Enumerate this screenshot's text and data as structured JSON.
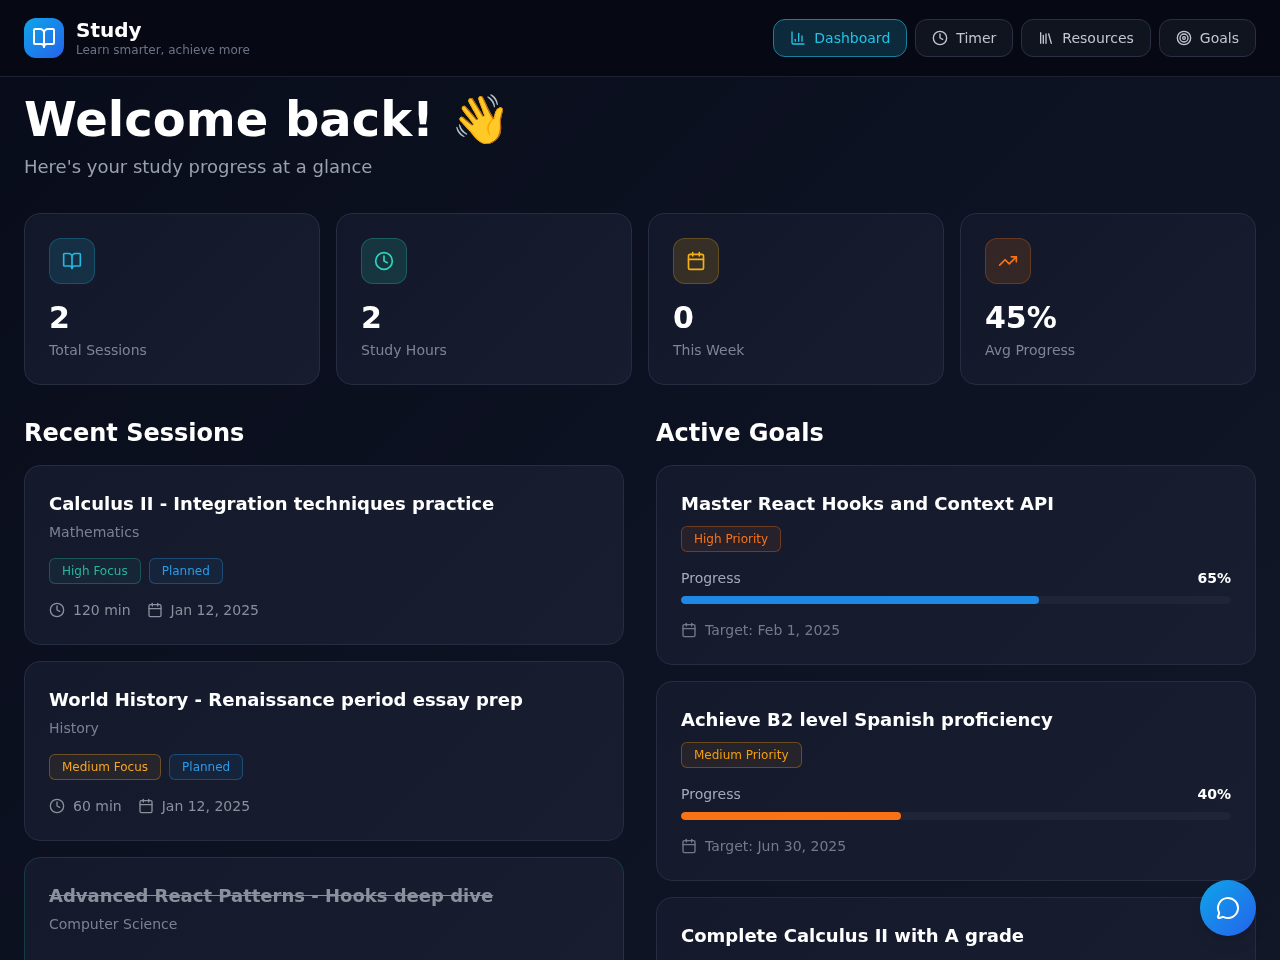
{
  "header": {
    "title": "Study",
    "subtitle": "Learn smarter, achieve more"
  },
  "nav": [
    {
      "label": "Dashboard",
      "selected": true
    },
    {
      "label": "Timer",
      "selected": false
    },
    {
      "label": "Resources",
      "selected": false
    },
    {
      "label": "Goals",
      "selected": false
    }
  ],
  "welcome": {
    "title": "Welcome back! 👋",
    "subtitle": "Here's your study progress at a glance"
  },
  "stats": [
    {
      "value": "2",
      "label": "Total Sessions",
      "color": "#22b8e0"
    },
    {
      "value": "2",
      "label": "Study Hours",
      "color": "#2dd4bf"
    },
    {
      "value": "0",
      "label": "This Week",
      "color": "#f5b014"
    },
    {
      "value": "45%",
      "label": "Avg Progress",
      "color": "#f97316"
    }
  ],
  "recent_sessions": {
    "heading": "Recent Sessions",
    "sessions": [
      {
        "title": "Calculus II - Integration techniques practice",
        "subject": "Mathematics",
        "completed": false,
        "tags": [
          {
            "label": "High Focus",
            "color": "#2ab3a0"
          },
          {
            "label": "Planned",
            "color": "#2b9be8"
          }
        ],
        "duration": "120 min",
        "date": "Jan 12, 2025"
      },
      {
        "title": "World History - Renaissance period essay prep",
        "subject": "History",
        "completed": false,
        "tags": [
          {
            "label": "Medium Focus",
            "color": "#f5a623"
          },
          {
            "label": "Planned",
            "color": "#2b9be8"
          }
        ],
        "duration": "60 min",
        "date": "Jan 12, 2025"
      },
      {
        "title": "Advanced React Patterns - Hooks deep dive",
        "subject": "Computer Science",
        "completed": true
      }
    ]
  },
  "active_goals": {
    "heading": "Active Goals",
    "goals": [
      {
        "title": "Master React Hooks and Context API",
        "priority": {
          "label": "High Priority",
          "color": "#f97316"
        },
        "progress_label": "Progress",
        "reading": "65%",
        "level": 0.65,
        "color": "#1e88e5",
        "target": "Target: Feb 1, 2025"
      },
      {
        "title": "Achieve B2 level Spanish proficiency",
        "priority": {
          "label": "Medium Priority",
          "color": "#f59e0b"
        },
        "progress_label": "Progress",
        "reading": "40%",
        "level": 0.4,
        "color": "#f97316",
        "target": "Target: Jun 30, 2025"
      },
      {
        "title": "Complete Calculus II with A grade"
      }
    ]
  }
}
